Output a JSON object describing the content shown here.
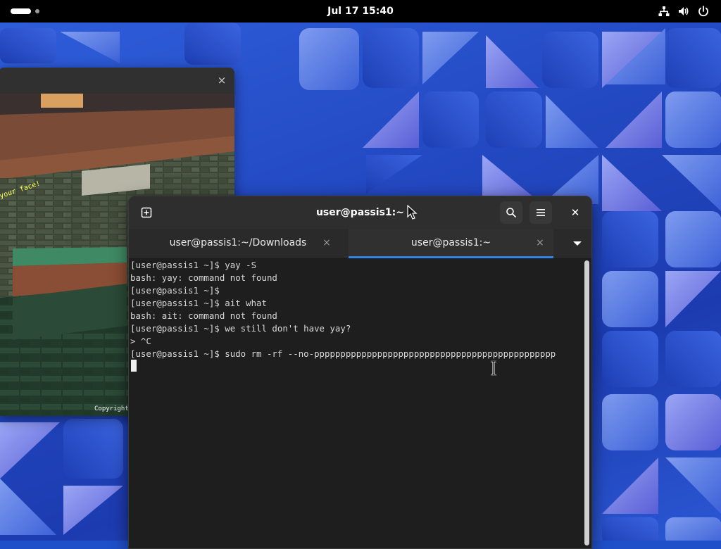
{
  "topbar": {
    "datetime": "Jul 17  15:40",
    "icons": [
      "activities-workspace-indicator",
      "network-icon",
      "volume-icon",
      "power-icon"
    ]
  },
  "game_window": {
    "close_label": "×",
    "splash_text": "your face!",
    "copyright_text": "Copyright"
  },
  "terminal": {
    "title": "user@passis1:~",
    "new_tab_icon": "new-tab-icon",
    "search_icon": "search-icon",
    "menu_icon": "hamburger-menu-icon",
    "close_label": "✕",
    "tabs": [
      {
        "label": "user@passis1:~/Downloads",
        "close": "×",
        "active": false
      },
      {
        "label": "user@passis1:~",
        "close": "×",
        "active": true
      }
    ],
    "lines": [
      "[user@passis1 ~]$ yay -S",
      "bash: yay: command not found",
      "[user@passis1 ~]$",
      "[user@passis1 ~]$ ait what",
      "bash: ait: command not found",
      "[user@passis1 ~]$ we still don't have yay?",
      "> ^C",
      "[user@passis1 ~]$ sudo rm -rf --no-pppppppppppppppppppppppppppppppppppppppppppppp"
    ]
  },
  "colors": {
    "accent": "#3584e4",
    "terminal_bg": "#1e1e1e",
    "topbar_bg": "#000000"
  }
}
